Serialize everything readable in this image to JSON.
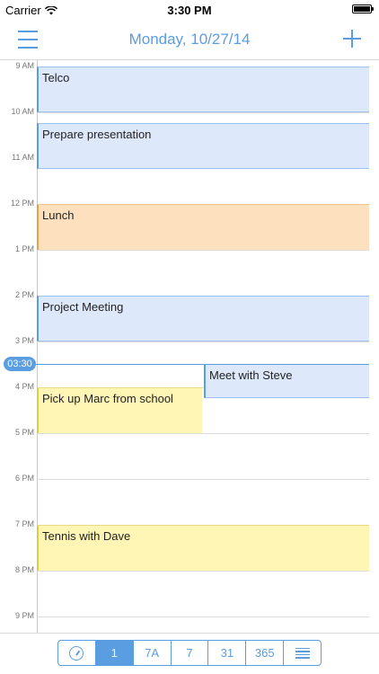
{
  "status_bar": {
    "carrier": "Carrier",
    "time": "3:30 PM"
  },
  "nav": {
    "title": "Monday, 10/27/14"
  },
  "hours": [
    "9 AM",
    "10 AM",
    "11 AM",
    "12 PM",
    "1 PM",
    "2 PM",
    "3 PM",
    "4 PM",
    "5 PM",
    "6 PM",
    "7 PM",
    "8 PM",
    "9 PM"
  ],
  "now_badge": "03:30",
  "events": [
    {
      "title": "Telco",
      "color": "blue"
    },
    {
      "title": "Prepare presentation",
      "color": "blue"
    },
    {
      "title": "Lunch",
      "color": "orange"
    },
    {
      "title": "Project Meeting",
      "color": "blue"
    },
    {
      "title": "Meet with Steve",
      "color": "blue"
    },
    {
      "title": "Pick up Marc from school",
      "color": "yellow"
    },
    {
      "title": "Tennis with Dave",
      "color": "yellow"
    }
  ],
  "toolbar": {
    "segments": [
      {
        "label": "",
        "icon": "gauge-icon"
      },
      {
        "label": "1",
        "active": true
      },
      {
        "label": "7A"
      },
      {
        "label": "7"
      },
      {
        "label": "31"
      },
      {
        "label": "365"
      },
      {
        "label": "",
        "icon": "list-icon"
      }
    ]
  },
  "colors": {
    "accent": "#5a9de0",
    "blue_event": "#dde9fb",
    "orange_event": "#fde0be",
    "yellow_event": "#fff6b5"
  }
}
